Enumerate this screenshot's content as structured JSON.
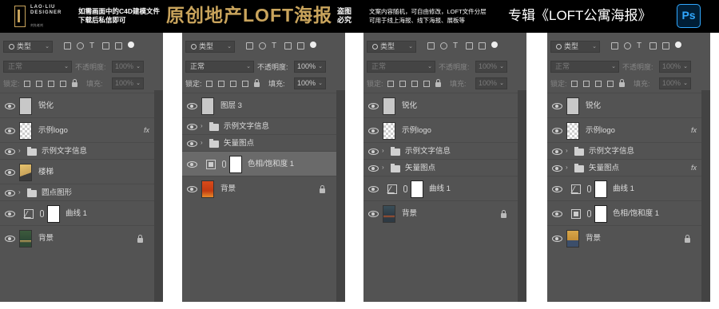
{
  "banner": {
    "logo_line1": "LAO·LIU",
    "logo_line2": "DESIGNER",
    "logo_small": "刘先老刘",
    "note1_line1": "如需画面中的C4D建模文件",
    "note1_line2": "下载后私信即可",
    "title": "原创地产LOFT海报",
    "stamp_line1": "盗图",
    "stamp_line2": "必究",
    "note2_line1": "文案内容随机，可自由修改，LOFT文件分层",
    "note2_line2": "可用于线上海报、线下海报、展板等",
    "special": "专辑《LOFT公寓海报》",
    "ps_badge": "Ps"
  },
  "panels": [
    {
      "filter_label": "类型",
      "blend_mode": "正常",
      "opacity_label": "不透明度:",
      "opacity_value": "100%",
      "lock_label": "锁定:",
      "fill_label": "填充:",
      "fill_value": "100%",
      "dimmed": true,
      "layers": [
        {
          "name": "锐化",
          "kind": "pixel",
          "thumb": "gray"
        },
        {
          "name": "示例logo",
          "kind": "smart",
          "thumb": "checker",
          "fx": "fx"
        },
        {
          "name": "示例文字信息",
          "kind": "group"
        },
        {
          "name": "楼梯",
          "kind": "pixel",
          "thumb": "gold"
        },
        {
          "name": "圆点图形",
          "kind": "group"
        },
        {
          "name": "曲线 1",
          "kind": "adjust",
          "adj": "curve",
          "indent": true
        },
        {
          "name": "背景",
          "kind": "background",
          "thumb": "green"
        }
      ]
    },
    {
      "filter_label": "类型",
      "blend_mode": "正常",
      "opacity_label": "不透明度:",
      "opacity_value": "100%",
      "lock_label": "锁定:",
      "fill_label": "填充:",
      "fill_value": "100%",
      "dimmed": false,
      "layers": [
        {
          "name": "图层 3",
          "kind": "pixel",
          "thumb": "gray"
        },
        {
          "name": "示例文字信息",
          "kind": "group"
        },
        {
          "name": "矢量图点",
          "kind": "group"
        },
        {
          "name": "色相/饱和度 1",
          "kind": "adjust",
          "adj": "hue",
          "selected": true
        },
        {
          "name": "背景",
          "kind": "background",
          "thumb": "red"
        }
      ]
    },
    {
      "filter_label": "类型",
      "blend_mode": "正常",
      "opacity_label": "不透明度:",
      "opacity_value": "100%",
      "lock_label": "锁定:",
      "fill_label": "填充:",
      "fill_value": "100%",
      "dimmed": true,
      "layers": [
        {
          "name": "锐化",
          "kind": "pixel",
          "thumb": "gray"
        },
        {
          "name": "示例logo",
          "kind": "smart",
          "thumb": "checker"
        },
        {
          "name": "示例文字信息",
          "kind": "group"
        },
        {
          "name": "矢量图点",
          "kind": "group"
        },
        {
          "name": "曲线 1",
          "kind": "adjust",
          "adj": "curve"
        },
        {
          "name": "背景",
          "kind": "background",
          "thumb": "teal"
        }
      ]
    },
    {
      "filter_label": "类型",
      "blend_mode": "正常",
      "opacity_label": "不透明度:",
      "opacity_value": "100%",
      "lock_label": "锁定:",
      "fill_label": "填充:",
      "fill_value": "100%",
      "dimmed": true,
      "layers": [
        {
          "name": "锐化",
          "kind": "pixel",
          "thumb": "gray"
        },
        {
          "name": "示例logo",
          "kind": "smart",
          "thumb": "checker",
          "fx": "fx"
        },
        {
          "name": "示例文字信息",
          "kind": "group"
        },
        {
          "name": "矢量图点",
          "kind": "group",
          "fx": "fx"
        },
        {
          "name": "曲线 1",
          "kind": "adjust",
          "adj": "curve"
        },
        {
          "name": "色相/饱和度 1",
          "kind": "adjust",
          "adj": "hue"
        },
        {
          "name": "背景",
          "kind": "background",
          "thumb": "ochre"
        }
      ]
    }
  ]
}
